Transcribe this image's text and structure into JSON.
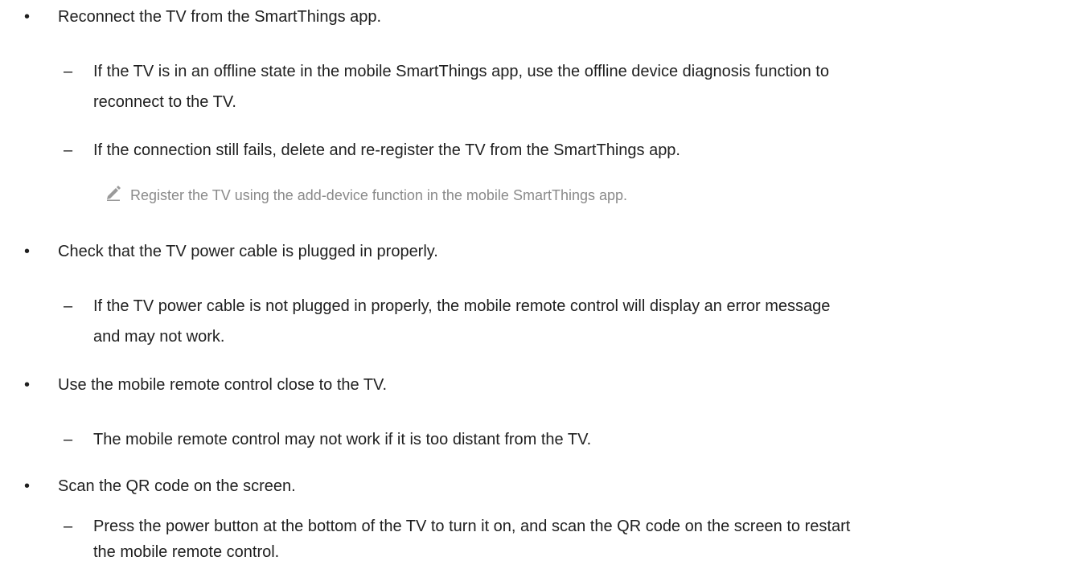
{
  "items": [
    {
      "text": "Reconnect the TV from the SmartThings app.",
      "subitems": [
        {
          "lines": [
            "If the TV is in an offline state in the mobile SmartThings app, use the offline device diagnosis function to",
            "reconnect to the TV."
          ]
        },
        {
          "lines": [
            "If the connection still fails, delete and re-register the TV from the SmartThings app."
          ]
        }
      ],
      "note": {
        "icon": "pencil-icon",
        "text": "Register the TV using the add-device function in the mobile SmartThings app."
      }
    },
    {
      "text": "Check that the TV power cable is plugged in properly.",
      "subitems": [
        {
          "lines": [
            "If the TV power cable is not plugged in properly, the mobile remote control will display an error message",
            "and may not work."
          ]
        }
      ]
    },
    {
      "text": "Use the mobile remote control close to the TV.",
      "subitems": [
        {
          "lines": [
            "The mobile remote control may not work if it is too distant from the TV."
          ]
        }
      ]
    },
    {
      "text": "Scan the QR code on the screen.",
      "subitems": [
        {
          "lines": [
            "Press the power button at the bottom of the TV to turn it on, and scan the QR code on the screen to restart",
            "the mobile remote control."
          ]
        }
      ]
    }
  ],
  "bullet_glyph": "•",
  "dash_glyph": "–"
}
